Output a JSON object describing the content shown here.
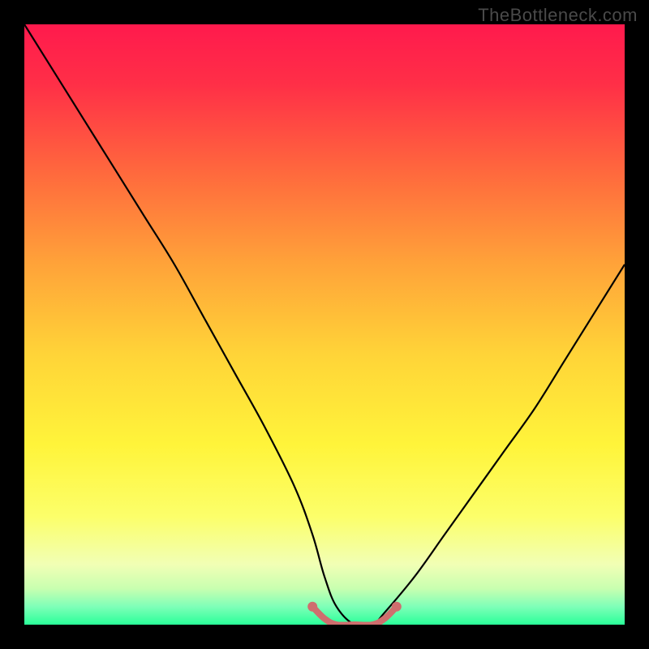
{
  "watermark": "TheBottleneck.com",
  "chart_data": {
    "type": "line",
    "title": "",
    "xlabel": "",
    "ylabel": "",
    "xlim": [
      0,
      100
    ],
    "ylim": [
      0,
      100
    ],
    "series": [
      {
        "name": "curve",
        "color": "#000000",
        "x": [
          0,
          5,
          10,
          15,
          20,
          25,
          30,
          35,
          40,
          45,
          48,
          50,
          52,
          55,
          58,
          60,
          65,
          70,
          75,
          80,
          85,
          90,
          95,
          100
        ],
        "y": [
          100,
          92,
          84,
          76,
          68,
          60,
          51,
          42,
          33,
          23,
          15,
          8,
          3,
          0,
          0,
          2,
          8,
          15,
          22,
          29,
          36,
          44,
          52,
          60
        ]
      },
      {
        "name": "highlight",
        "color": "#cf6e6e",
        "x": [
          48,
          50,
          52,
          55,
          58,
          60,
          62
        ],
        "y": [
          3,
          1,
          0,
          0,
          0,
          1,
          3
        ]
      }
    ],
    "gradient_stops": [
      {
        "offset": 0.0,
        "color": "#ff1a4d"
      },
      {
        "offset": 0.1,
        "color": "#ff2f47"
      },
      {
        "offset": 0.25,
        "color": "#ff6a3d"
      },
      {
        "offset": 0.4,
        "color": "#ffa339"
      },
      {
        "offset": 0.55,
        "color": "#ffd438"
      },
      {
        "offset": 0.7,
        "color": "#fff43a"
      },
      {
        "offset": 0.82,
        "color": "#fcff6a"
      },
      {
        "offset": 0.9,
        "color": "#f1ffb5"
      },
      {
        "offset": 0.94,
        "color": "#c8ffb0"
      },
      {
        "offset": 0.97,
        "color": "#7effb8"
      },
      {
        "offset": 1.0,
        "color": "#2aff99"
      }
    ]
  }
}
